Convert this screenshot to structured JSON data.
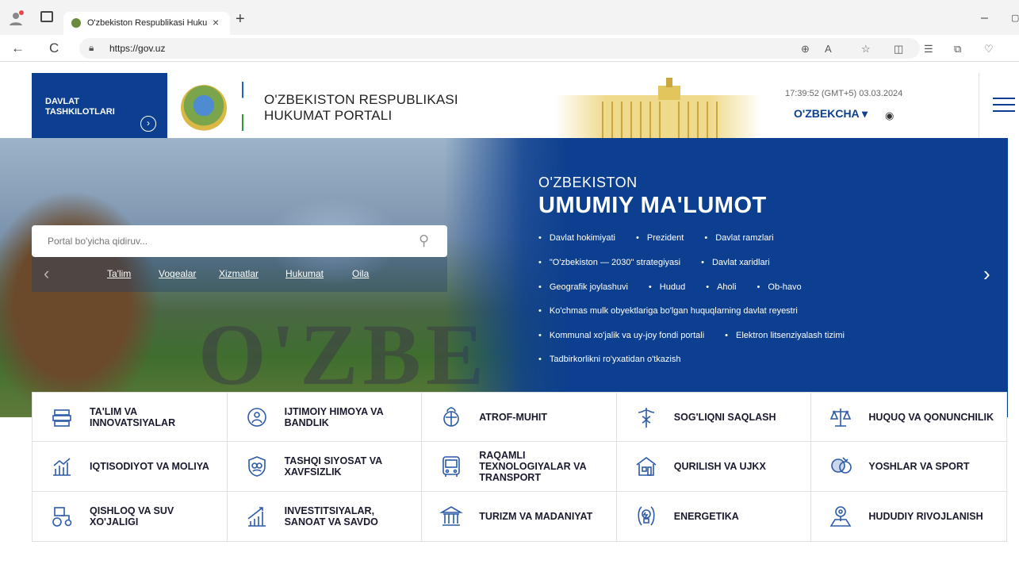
{
  "browser": {
    "tab_title": "O'zbekiston Respublikasi Hukum",
    "tab_close": "×",
    "new_tab": "+",
    "url": "https://gov.uz",
    "back": "←",
    "reload": "C",
    "minimize": "–",
    "restore": "▢"
  },
  "header": {
    "gov_orgs_label": "DAVLAT TASHKILOTLARI",
    "portal_title_line1": "O'ZBEKISTON RESPUBLIKASI",
    "portal_title_line2": "HUKUMAT PORTALI",
    "datetime": "17:39:52 (GMT+5) 03.03.2024",
    "language": "O'ZBEKCHA ▾"
  },
  "search": {
    "placeholder": "Portal bo'yicha qidiruv..."
  },
  "quick_links": [
    "Ta'lim",
    "Voqealar",
    "Xizmatlar",
    "Hukumat",
    "Oila"
  ],
  "info": {
    "subtitle": "O'ZBEKISTON",
    "title": "UMUMIY MA'LUMOT",
    "rows": [
      [
        "Davlat hokimiyati",
        "Prezident",
        "Davlat ramzlari"
      ],
      [
        "\"O'zbekiston — 2030\" strategiyasi",
        "Davlat xaridlari"
      ],
      [
        "Geografik joylashuvi",
        "Hudud",
        "Aholi",
        "Ob-havo"
      ],
      [
        "Ko'chmas mulk obyektlariga bo'lgan huquqlarning davlat reyestri"
      ],
      [
        "Kommunal xo'jalik va uy-joy fondi portali",
        "Elektron litsenziyalash tizimi"
      ],
      [
        "Tadbirkorlikni ro'yxatidan o'tkazish"
      ]
    ]
  },
  "categories": [
    {
      "label": "TA'LIM VA INNOVATSIYALAR",
      "icon": "education-icon"
    },
    {
      "label": "IJTIMOIY HIMOYA VA BANDLIK",
      "icon": "social-protection-icon"
    },
    {
      "label": "ATROF-MUHIT",
      "icon": "environment-icon"
    },
    {
      "label": "SOG'LIQNI SAQLASH",
      "icon": "healthcare-icon"
    },
    {
      "label": "HUQUQ VA QONUNCHILIK",
      "icon": "law-scales-icon"
    },
    {
      "label": "IQTISODIYOT VA MOLIYA",
      "icon": "economy-icon"
    },
    {
      "label": "TASHQI SIYOSAT VA XAVFSIZLIK",
      "icon": "security-shield-icon"
    },
    {
      "label": "RAQAMLI TEXNOLOGIYALAR VA TRANSPORT",
      "icon": "digital-transport-icon"
    },
    {
      "label": "QURILISH VA UJKX",
      "icon": "construction-icon"
    },
    {
      "label": "YOSHLAR VA SPORT",
      "icon": "sport-icon"
    },
    {
      "label": "QISHLOQ VA SUV XO'JALIGI",
      "icon": "tractor-icon"
    },
    {
      "label": "INVESTITSIYALAR, SANOAT VA SAVDO",
      "icon": "investment-chart-icon"
    },
    {
      "label": "TURIZM VA MADANIYAT",
      "icon": "museum-icon"
    },
    {
      "label": "ENERGETIKA",
      "icon": "energy-icon"
    },
    {
      "label": "HUDUDIY RIVOJLANISH",
      "icon": "map-pin-icon"
    }
  ],
  "colors": {
    "brand_blue": "#0c3f8f",
    "icon_blue": "#2b5aa8"
  }
}
